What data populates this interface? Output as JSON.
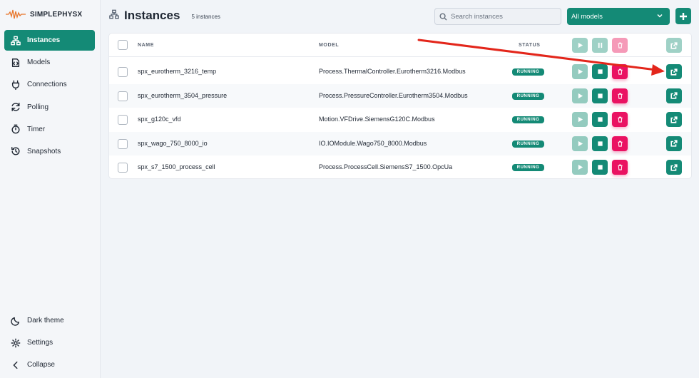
{
  "app": {
    "name": "SIMPLEPHYSX"
  },
  "sidebar": {
    "items": [
      {
        "label": "Instances",
        "icon": "hierarchy-icon",
        "active": true
      },
      {
        "label": "Models",
        "icon": "models-icon"
      },
      {
        "label": "Connections",
        "icon": "plug-icon"
      },
      {
        "label": "Polling",
        "icon": "refresh-icon"
      },
      {
        "label": "Timer",
        "icon": "timer-icon"
      },
      {
        "label": "Snapshots",
        "icon": "history-icon"
      }
    ],
    "bottom": [
      {
        "label": "Dark theme",
        "icon": "moon-icon"
      },
      {
        "label": "Settings",
        "icon": "gear-icon"
      },
      {
        "label": "Collapse",
        "icon": "chevron-left-icon"
      }
    ]
  },
  "header": {
    "title": "Instances",
    "count": "5 instances",
    "search_placeholder": "Search instances",
    "model_filter": "All models"
  },
  "table": {
    "columns": {
      "name": "NAME",
      "model": "MODEL",
      "status": "STATUS"
    },
    "rows": [
      {
        "name": "spx_eurotherm_3216_temp",
        "model": "Process.ThermalController.Eurotherm3216.Modbus",
        "status": "RUNNING"
      },
      {
        "name": "spx_eurotherm_3504_pressure",
        "model": "Process.PressureController.Eurotherm3504.Modbus",
        "status": "RUNNING"
      },
      {
        "name": "spx_g120c_vfd",
        "model": "Motion.VFDrive.SiemensG120C.Modbus",
        "status": "RUNNING"
      },
      {
        "name": "spx_wago_750_8000_io",
        "model": "IO.IOModule.Wago750_8000.Modbus",
        "status": "RUNNING"
      },
      {
        "name": "spx_s7_1500_process_cell",
        "model": "Process.ProcessCell.SiemensS7_1500.OpcUa",
        "status": "RUNNING"
      }
    ]
  },
  "colors": {
    "accent": "#148a76",
    "danger": "#ea1262",
    "annotation_arrow": "#e3261b"
  }
}
